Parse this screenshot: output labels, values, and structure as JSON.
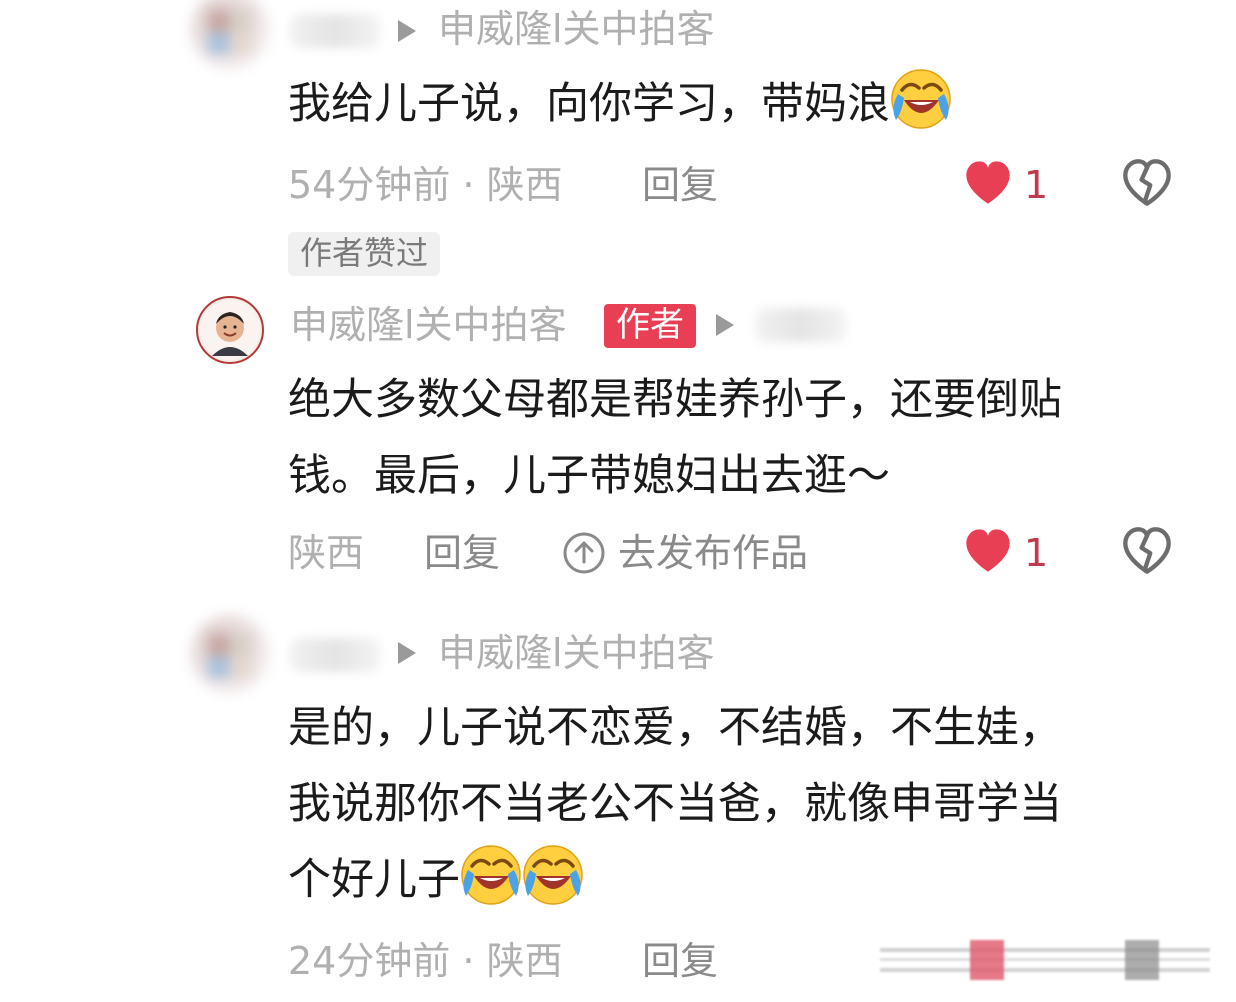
{
  "comments": [
    {
      "reply_to": "申威隆l关中拍客",
      "text": "我给儿子说，向你学习，带妈浪",
      "emoji": "grinning-squinting-face-emoji",
      "time": "54分钟前 · 陕西",
      "reply_label": "回复",
      "likes": "1",
      "tag": "作者赞过"
    },
    {
      "author": "申威隆l关中拍客",
      "author_badge": "作者",
      "text_line1": "绝大多数父母都是帮娃养孙子，还要倒贴",
      "text_line2": "钱。最后，儿子带媳妇出去逛～",
      "location": "陕西",
      "reply_label": "回复",
      "publish_label": "去发布作品",
      "likes": "1"
    },
    {
      "reply_to": "申威隆l关中拍客",
      "text_line1": "是的，儿子说不恋爱，不结婚，不生娃，",
      "text_line2": "我说那你不当老公不当爸，就像申哥学当",
      "text_line3": "个好儿子",
      "time": "24分钟前 · 陕西",
      "reply_label": "回复"
    }
  ],
  "colors": {
    "like": "#e83f55",
    "badge": "#e83f55",
    "meta": "#b0b0b0"
  }
}
